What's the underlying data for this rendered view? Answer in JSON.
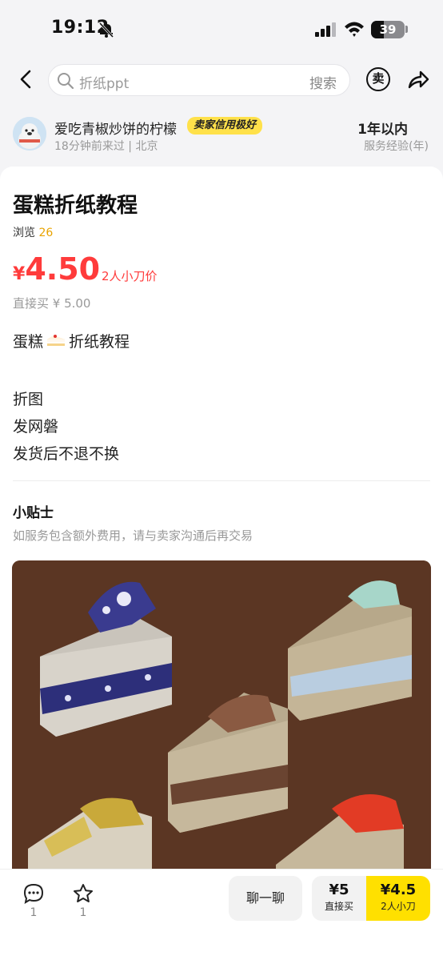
{
  "status_bar": {
    "time": "19:12",
    "battery": "39",
    "battery_level": 0.39
  },
  "nav": {
    "search_placeholder": "折纸ppt",
    "search_button": "搜索",
    "sell_icon_char": "卖"
  },
  "seller": {
    "name": "爱吃青椒炒饼的柠檬",
    "badge": "卖家信用极好",
    "last_seen": "18分钟前来过",
    "location": "北京",
    "experience_value": "1年以内",
    "experience_label": "服务经验(年)"
  },
  "product": {
    "title": "蛋糕折纸教程",
    "views_label": "浏览",
    "views": "26",
    "price_currency": "¥",
    "price": "4.50",
    "price_tag": "2人小刀价",
    "direct_price": "直接买 ¥ 5.00",
    "desc_line1_a": "蛋糕",
    "desc_line1_b": "折纸教程",
    "desc_lines": [
      "折图",
      "发网磐",
      "发货后不退不换"
    ]
  },
  "tips": {
    "title": "小贴士",
    "body": "如服务包含额外费用，请与卖家沟通后再交易"
  },
  "bottom": {
    "comment_count": "1",
    "favorite_count": "1",
    "chat_label": "聊一聊",
    "buy_price": "¥5",
    "buy_label": "直接买",
    "cut_price": "¥4.5",
    "cut_label": "2人小刀"
  },
  "colors": {
    "accent_yellow": "#ffe000",
    "price_red": "#ff3b3b",
    "views_orange": "#e8a300"
  }
}
